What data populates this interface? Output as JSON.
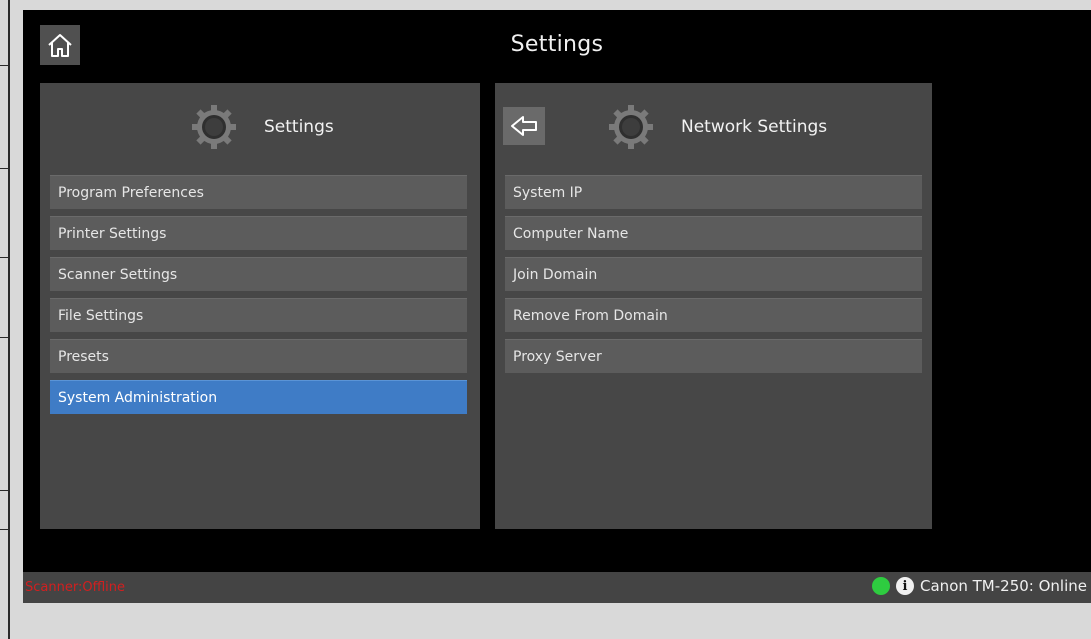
{
  "header": {
    "title": "Settings"
  },
  "left_panel": {
    "title": "Settings",
    "items": [
      {
        "label": "Program Preferences"
      },
      {
        "label": "Printer Settings"
      },
      {
        "label": "Scanner Settings"
      },
      {
        "label": "File Settings"
      },
      {
        "label": "Presets"
      },
      {
        "label": "System Administration"
      }
    ],
    "selected_item": "System Administration"
  },
  "right_panel": {
    "title": "Network Settings",
    "items": [
      {
        "label": "System IP"
      },
      {
        "label": "Computer Name"
      },
      {
        "label": "Join Domain"
      },
      {
        "label": "Remove From Domain"
      },
      {
        "label": "Proxy Server"
      }
    ]
  },
  "status_bar": {
    "scanner_status": "Scanner:Offline",
    "info_glyph": "i",
    "printer_status": "Canon TM-250: Online",
    "online_color": "#2ecc40",
    "offline_color": "#d21f1f"
  },
  "colors": {
    "selected": "#3f7cc6",
    "panel": "#474747",
    "item": "#5c5c5c"
  }
}
